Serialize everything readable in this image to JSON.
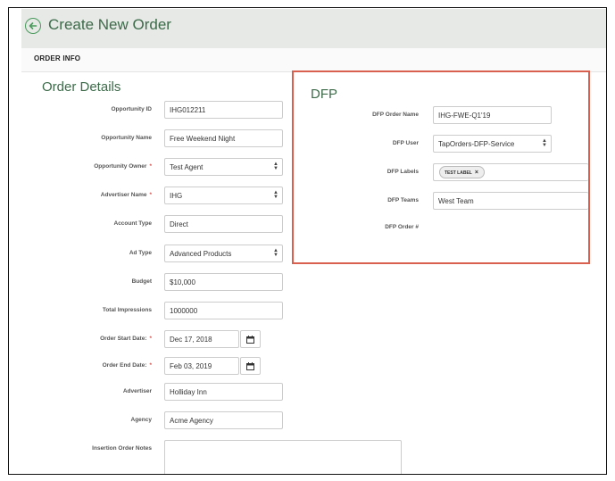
{
  "header": {
    "title": "Create New Order"
  },
  "section": {
    "title": "ORDER INFO"
  },
  "order_details": {
    "title": "Order Details",
    "fields": {
      "opportunity_id": {
        "label": "Opportunity ID",
        "value": "IHG012211"
      },
      "opportunity_name": {
        "label": "Opportunity Name",
        "value": "Free Weekend Night"
      },
      "opportunity_owner": {
        "label": "Opportunity Owner",
        "value": "Test Agent"
      },
      "advertiser_name": {
        "label": "Advertiser Name",
        "value": "IHG"
      },
      "account_type": {
        "label": "Account Type",
        "value": "Direct"
      },
      "ad_type": {
        "label": "Ad Type",
        "value": "Advanced Products"
      },
      "budget": {
        "label": "Budget",
        "value": "$10,000"
      },
      "total_impressions": {
        "label": "Total Impressions",
        "value": "1000000"
      },
      "order_start_date": {
        "label": "Order Start Date:",
        "value": "Dec 17, 2018"
      },
      "order_end_date": {
        "label": "Order End Date:",
        "value": "Feb 03, 2019"
      },
      "advertiser": {
        "label": "Advertiser",
        "value": "Holliday Inn"
      },
      "agency": {
        "label": "Agency",
        "value": "Acme Agency"
      },
      "insertion_order_notes": {
        "label": "Insertion Order Notes",
        "value": ""
      }
    },
    "required_marker": "*"
  },
  "dfp": {
    "title": "DFP",
    "fields": {
      "order_name": {
        "label": "DFP Order Name",
        "value": "IHG-FWE-Q1'19"
      },
      "user": {
        "label": "DFP User",
        "value": "TapOrders-DFP-Service"
      },
      "labels": {
        "label": "DFP Labels",
        "tags": [
          "TEST LABEL"
        ],
        "remove_glyph": "×"
      },
      "teams": {
        "label": "DFP Teams",
        "value": "West Team"
      },
      "order_number": {
        "label": "DFP Order #",
        "value": ""
      }
    }
  },
  "icons": {
    "back": "arrow-left-circle-icon",
    "select": "up-down-caret-icon",
    "calendar": "calendar-icon"
  },
  "colors": {
    "accent_green": "#3d6b4a",
    "highlight_border": "#d9604f",
    "required": "#d9534f"
  }
}
